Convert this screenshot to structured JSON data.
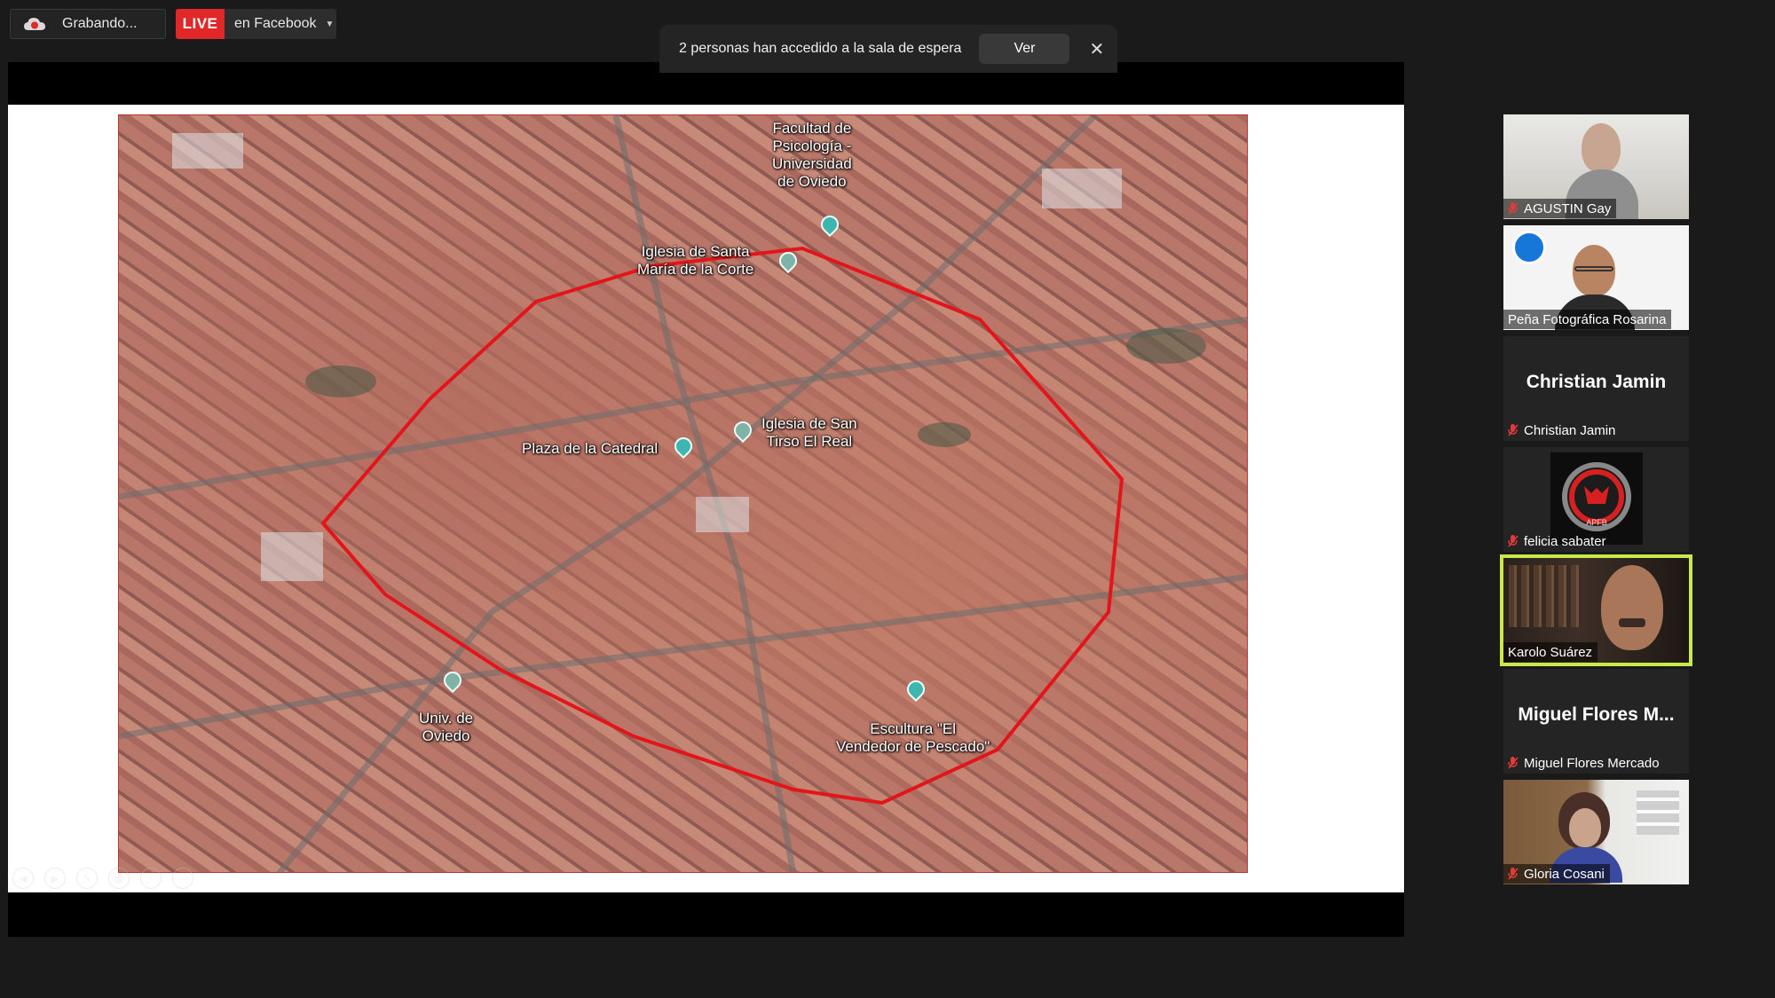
{
  "recording": {
    "label": "Grabando..."
  },
  "live": {
    "badge": "LIVE",
    "target": "en Facebook"
  },
  "notification": {
    "text": "2 personas han accedido a la sala de espera",
    "view_button": "Ver",
    "close_icon": "close-icon"
  },
  "map": {
    "labels": {
      "facultad": [
        "Facultad de",
        "Psicología -",
        "Universidad",
        "de Oviedo"
      ],
      "iglesia_corte": [
        "Iglesia de Santa",
        "María de la Corte"
      ],
      "iglesia_tirso": [
        "Iglesia de San",
        "Tirso El Real"
      ],
      "plaza": "Plaza de la Catedral",
      "univ": [
        "Univ. de",
        "Oviedo"
      ],
      "escultura": [
        "Escultura \"El",
        "Vendedor de Pescado\""
      ]
    },
    "outline_color": "#e3151a"
  },
  "participants": [
    {
      "name": "AGUSTIN Gay",
      "muted": true,
      "video": true
    },
    {
      "name": "Peña Fotográfica Rosarina",
      "muted": false,
      "video": true
    },
    {
      "name": "Christian Jamin",
      "display": "Christian Jamin",
      "muted": true,
      "video": false
    },
    {
      "name": "felicia sabater",
      "muted": true,
      "video": true
    },
    {
      "name": "Karolo Suárez",
      "muted": false,
      "video": true,
      "active_speaker": true
    },
    {
      "name": "Miguel Flores Mercado",
      "display": "Miguel Flores M...",
      "muted": true,
      "video": false
    },
    {
      "name": "Gloria Cosani",
      "muted": true,
      "video": true
    }
  ],
  "colors": {
    "live_red": "#e02828",
    "active_speaker": "#c9e84a",
    "muted_red": "#e03a3a"
  }
}
